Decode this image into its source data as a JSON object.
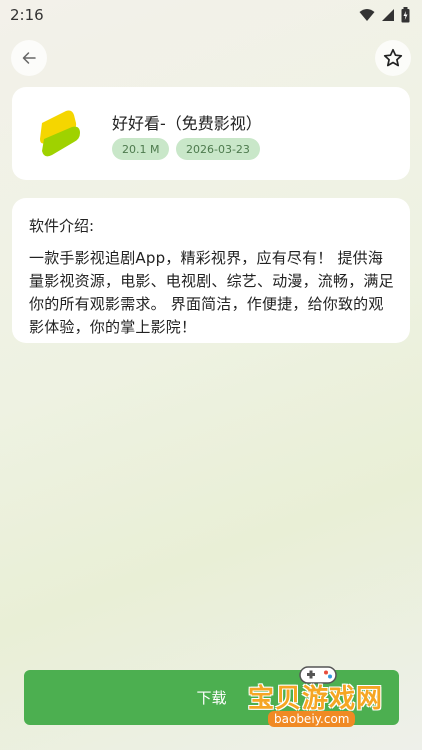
{
  "status_bar": {
    "time": "2:16"
  },
  "header": {
    "back_icon": "arrow-left-icon",
    "favorite_icon": "star-outline-icon"
  },
  "app": {
    "name": "好好看-（免费影视）",
    "size": "20.1 M",
    "date": "2026-03-23",
    "logo_colors": [
      "#f5d600",
      "#9fd200"
    ],
    "tag_bg": "#c9e7c9"
  },
  "intro": {
    "heading": "软件介绍:",
    "body": "一款手影视追剧App，精彩视界，应有尽有！ 提供海量影视资源，电影、电视剧、综艺、动漫，流畅，满足你的所有观影需求。 界面简洁，作便捷，给你致的观影体验，你的掌上影院！"
  },
  "download": {
    "label": "下载",
    "color": "#4caf50"
  },
  "watermark": {
    "text": "宝贝游戏网",
    "url": "baobeiy.com"
  }
}
